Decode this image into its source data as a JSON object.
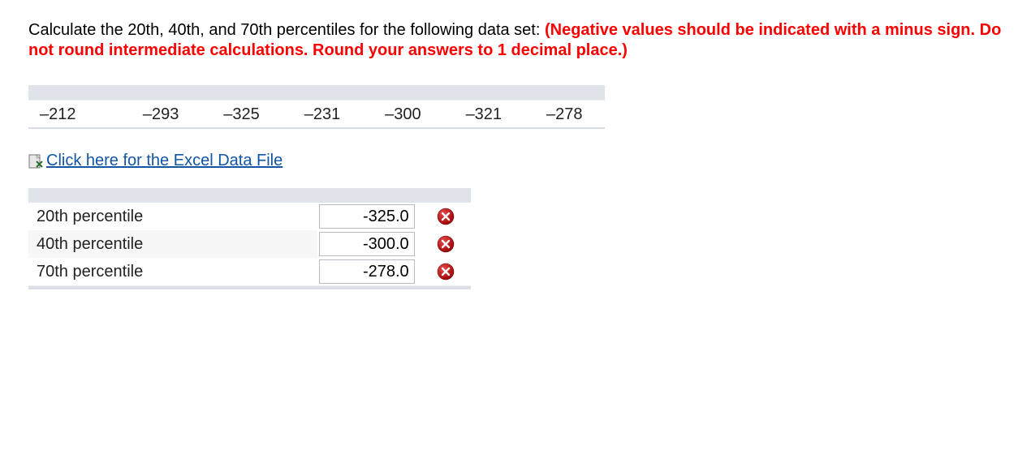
{
  "question": {
    "lead": "Calculate the 20th, 40th, and 70th percentiles for the following data set: ",
    "emphasis": "(Negative values should be indicated with a minus sign. Do not round intermediate calculations. Round your answers to 1 decimal place.)"
  },
  "dataset": [
    "–212",
    "–293",
    "–325",
    "–231",
    "–300",
    "–321",
    "–278"
  ],
  "excel_link_text": "Click here for the Excel Data File",
  "answers": [
    {
      "label": "20th percentile",
      "value": "-325.0",
      "status": "wrong"
    },
    {
      "label": "40th percentile",
      "value": "-300.0",
      "status": "wrong"
    },
    {
      "label": "70th percentile",
      "value": "-278.0",
      "status": "wrong"
    }
  ]
}
